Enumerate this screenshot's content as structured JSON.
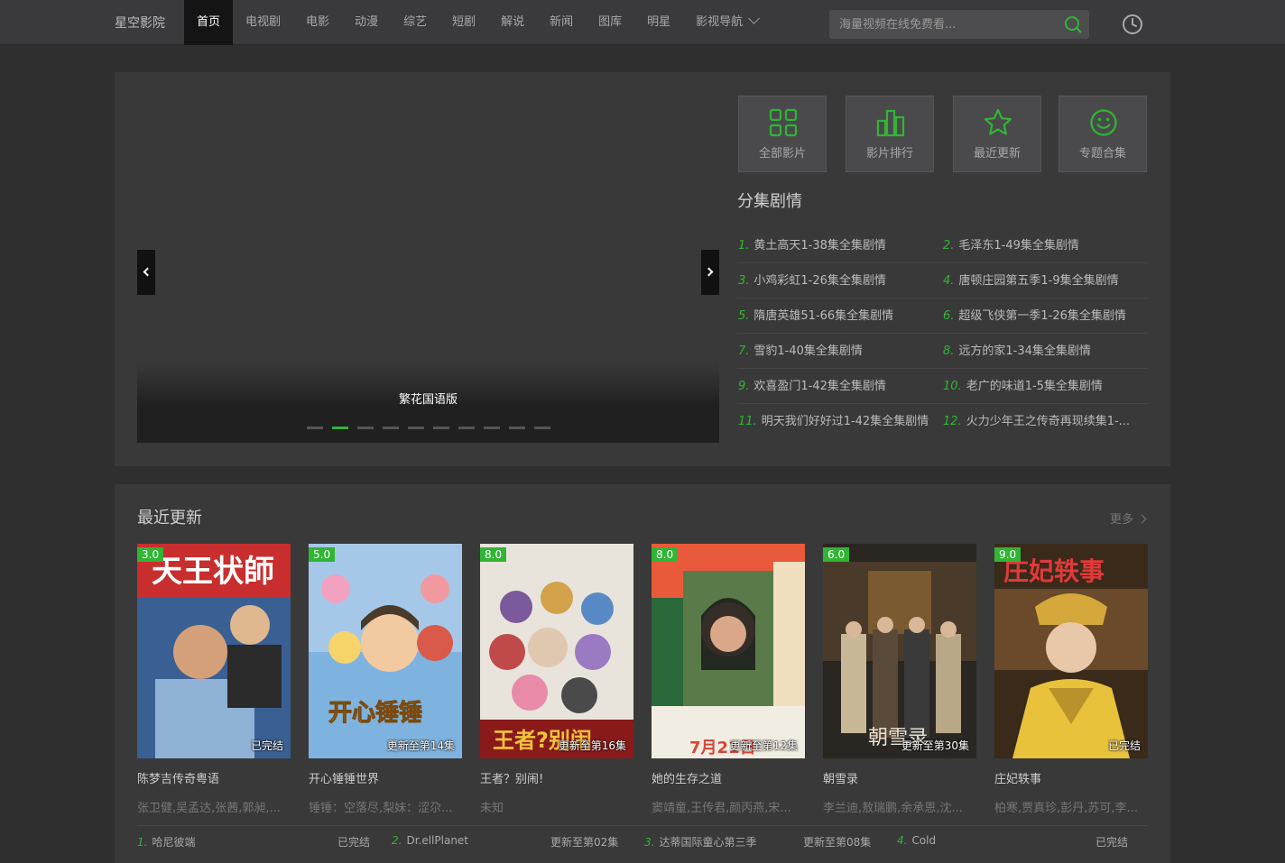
{
  "header": {
    "logo": "星空影院",
    "nav": [
      "首页",
      "电视剧",
      "电影",
      "动漫",
      "综艺",
      "短剧",
      "解说",
      "新闻",
      "图库",
      "明星"
    ],
    "nav_dropdown": "影视导航",
    "search_placeholder": "海量视频在线免费看...",
    "accent_color": "#31b534"
  },
  "banner": {
    "title": "繁花国语版",
    "slide_count": 10,
    "active_slide": 2
  },
  "quick_links": [
    {
      "label": "全部影片",
      "icon": "grid-icon"
    },
    {
      "label": "影片排行",
      "icon": "ranking-icon"
    },
    {
      "label": "最近更新",
      "icon": "star-icon"
    },
    {
      "label": "专题合集",
      "icon": "smile-icon"
    }
  ],
  "plot_section": {
    "title": "分集剧情",
    "items": [
      {
        "num": "1.",
        "text": "黄土高天1-38集全集剧情"
      },
      {
        "num": "2.",
        "text": "毛泽东1-49集全集剧情"
      },
      {
        "num": "3.",
        "text": "小鸡彩虹1-26集全集剧情"
      },
      {
        "num": "4.",
        "text": "唐顿庄园第五季1-9集全集剧情"
      },
      {
        "num": "5.",
        "text": "隋唐英雄51-66集全集剧情"
      },
      {
        "num": "6.",
        "text": "超级飞侠第一季1-26集全集剧情"
      },
      {
        "num": "7.",
        "text": "雪豹1-40集全集剧情"
      },
      {
        "num": "8.",
        "text": "远方的家1-34集全集剧情"
      },
      {
        "num": "9.",
        "text": "欢喜盈门1-42集全集剧情"
      },
      {
        "num": "10.",
        "text": "老广的味道1-5集全集剧情"
      },
      {
        "num": "11.",
        "text": "明天我们好好过1-42集全集剧情"
      },
      {
        "num": "12.",
        "text": "火力少年王之传奇再现续集1-..."
      }
    ]
  },
  "recent": {
    "title": "最近更新",
    "more": "更多",
    "cards": [
      {
        "title": "陈梦吉传奇粤语",
        "score": "3.0",
        "status": "已完结",
        "cast": "张卫健,吴孟达,张茜,郭昶,..."
      },
      {
        "title": "开心锤锤世界",
        "score": "5.0",
        "status": "更新至第14集",
        "cast": "锤锤：空落尽,梨妹：涩尕..."
      },
      {
        "title": "王者？别闹!",
        "score": "8.0",
        "status": "更新至第16集",
        "cast": "未知"
      },
      {
        "title": "她的生存之道",
        "score": "8.0",
        "status": "更新至第12集",
        "cast": "窦靖童,王传君,颜丙燕,宋..."
      },
      {
        "title": "朝雪录",
        "score": "6.0",
        "status": "更新至第30集",
        "cast": "李兰迪,敖瑞鹏,余承恩,沈..."
      },
      {
        "title": "庄妃轶事",
        "score": "9.0",
        "status": "已完结",
        "cast": "柏寒,贾真珍,彭丹,苏可,李..."
      }
    ],
    "rank_items": [
      {
        "num": "1.",
        "text": "哈尼彼端"
      },
      {
        "num": "",
        "text": "已完结"
      },
      {
        "num": "2.",
        "text": "Dr.ellPlanet"
      },
      {
        "num": "",
        "text": "更新至第02集"
      },
      {
        "num": "3.",
        "text": "达蒂国际童心第三季"
      },
      {
        "num": "",
        "text": "更新至第08集"
      },
      {
        "num": "4.",
        "text": "Cold"
      },
      {
        "num": "",
        "text": "已完结"
      }
    ]
  }
}
